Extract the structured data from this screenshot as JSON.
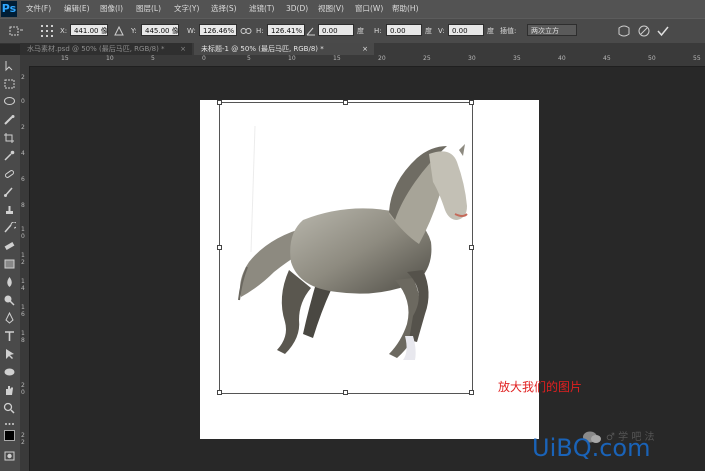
{
  "app": {
    "logo": "Ps"
  },
  "menu": [
    {
      "label": "文件(F)"
    },
    {
      "label": "编辑(E)"
    },
    {
      "label": "图像(I)"
    },
    {
      "label": "图层(L)"
    },
    {
      "label": "文字(Y)"
    },
    {
      "label": "选择(S)"
    },
    {
      "label": "滤镜(T)"
    },
    {
      "label": "3D(D)"
    },
    {
      "label": "视图(V)"
    },
    {
      "label": "窗口(W)"
    },
    {
      "label": "帮助(H)"
    }
  ],
  "options": {
    "x_label": "X:",
    "x_value": "441.00 像素",
    "y_label": "Y:",
    "y_value": "445.00 像素",
    "w_label": "W:",
    "w_value": "126.46%",
    "h_label": "H:",
    "h_value": "126.41%",
    "rotate_value": "0.00",
    "rotate_unit": "度",
    "hskew_label": "H:",
    "hskew_value": "0.00",
    "hskew_unit": "度",
    "vskew_label": "V:",
    "vskew_value": "0.00",
    "vskew_unit": "度",
    "interp_label": "插值:",
    "interp_value": "两次立方"
  },
  "tabs": [
    {
      "label": "水马素材.psd @ 50% (最后马匹, RGB/8) *",
      "close": "×"
    },
    {
      "label": "未标题-1 @ 50% (最后马匹, RGB/8) *",
      "close": "×"
    }
  ],
  "ruler_h": [
    "15",
    "10",
    "5",
    "0",
    "5",
    "10",
    "15",
    "20",
    "25",
    "30",
    "35",
    "40",
    "45",
    "50",
    "55"
  ],
  "ruler_v": [
    "2",
    "0",
    "2",
    "4",
    "6",
    "8",
    "1",
    "0",
    "1",
    "2",
    "1",
    "4",
    "1",
    "6",
    "1",
    "8",
    "2",
    "0",
    "2",
    "2"
  ],
  "canvas": {
    "annotation": "放大我们的图片"
  },
  "watermark": {
    "text": "UiBQ.com",
    "sub": "♂ 学 吧 法"
  },
  "colors": {
    "menubar": "#535353",
    "optbar": "#4a4a4a",
    "workspace": "#282828",
    "annotation": "#e02020",
    "watermark": "#1a63b8"
  }
}
